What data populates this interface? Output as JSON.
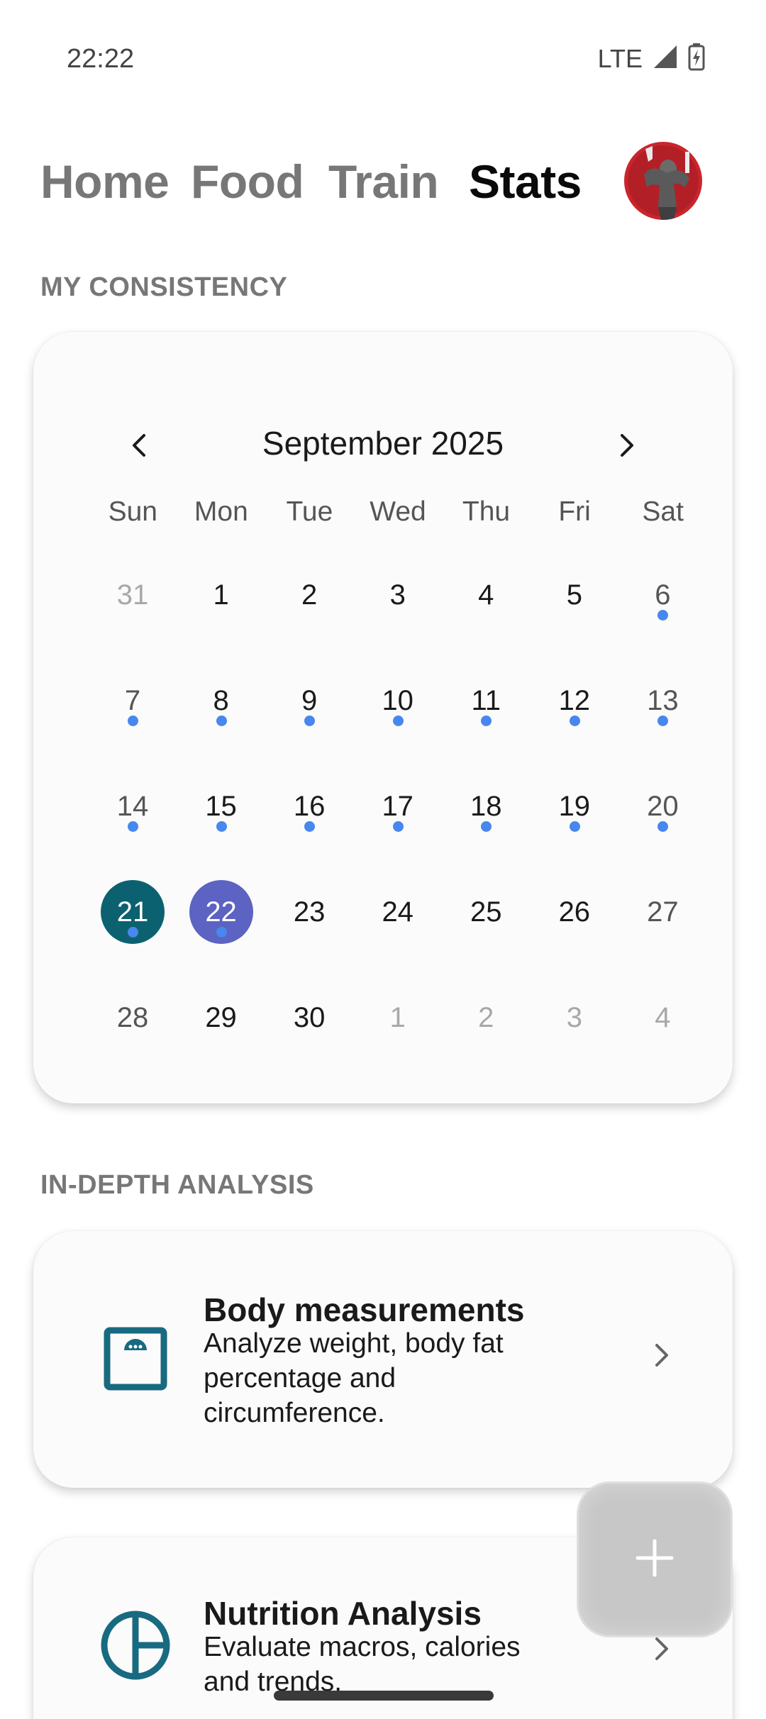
{
  "status_bar": {
    "time": "22:22",
    "network": "LTE"
  },
  "nav": {
    "tabs": [
      {
        "label": "Home",
        "active": false
      },
      {
        "label": "Food",
        "active": false
      },
      {
        "label": "Train",
        "active": false
      },
      {
        "label": "Stats",
        "active": true
      }
    ]
  },
  "consistency": {
    "section_label": "MY CONSISTENCY",
    "calendar": {
      "month_label": "September 2025",
      "weekdays": [
        "Sun",
        "Mon",
        "Tue",
        "Wed",
        "Thu",
        "Fri",
        "Sat"
      ],
      "weeks": [
        [
          {
            "day": "31",
            "muted": true,
            "dot": false
          },
          {
            "day": "1",
            "dot": false
          },
          {
            "day": "2",
            "dot": false
          },
          {
            "day": "3",
            "dot": false
          },
          {
            "day": "4",
            "dot": false
          },
          {
            "day": "5",
            "dot": false
          },
          {
            "day": "6",
            "dot": true
          }
        ],
        [
          {
            "day": "7",
            "dot": true
          },
          {
            "day": "8",
            "dot": true
          },
          {
            "day": "9",
            "dot": true
          },
          {
            "day": "10",
            "dot": true
          },
          {
            "day": "11",
            "dot": true
          },
          {
            "day": "12",
            "dot": true
          },
          {
            "day": "13",
            "dot": true
          }
        ],
        [
          {
            "day": "14",
            "dot": true
          },
          {
            "day": "15",
            "dot": true
          },
          {
            "day": "16",
            "dot": true
          },
          {
            "day": "17",
            "dot": true
          },
          {
            "day": "18",
            "dot": true
          },
          {
            "day": "19",
            "dot": true
          },
          {
            "day": "20",
            "dot": true
          }
        ],
        [
          {
            "day": "21",
            "dot": true,
            "state": "today"
          },
          {
            "day": "22",
            "dot": true,
            "state": "selected"
          },
          {
            "day": "23",
            "dot": false
          },
          {
            "day": "24",
            "dot": false
          },
          {
            "day": "25",
            "dot": false
          },
          {
            "day": "26",
            "dot": false
          },
          {
            "day": "27",
            "dot": false
          }
        ],
        [
          {
            "day": "28",
            "dot": false
          },
          {
            "day": "29",
            "dot": false
          },
          {
            "day": "30",
            "dot": false
          },
          {
            "day": "1",
            "muted": true,
            "dot": false
          },
          {
            "day": "2",
            "muted": true,
            "dot": false
          },
          {
            "day": "3",
            "muted": true,
            "dot": false
          },
          {
            "day": "4",
            "muted": true,
            "dot": false
          }
        ]
      ]
    }
  },
  "analysis": {
    "section_label": "IN-DEPTH ANALYSIS",
    "cards": [
      {
        "icon": "scale-icon",
        "title": "Body measurements",
        "description": "Analyze weight, body fat percentage and circumference."
      },
      {
        "icon": "pie-chart-icon",
        "title": "Nutrition Analysis",
        "description": "Evaluate macros, calories and trends."
      }
    ]
  },
  "colors": {
    "accent_teal": "#0c6170",
    "selected_purple": "#5c63c2",
    "dot_blue": "#4787ee",
    "icon_teal": "#186a80"
  },
  "icons": {
    "prev": "chevron-left-icon",
    "next": "chevron-right-icon",
    "fab": "plus-icon"
  }
}
